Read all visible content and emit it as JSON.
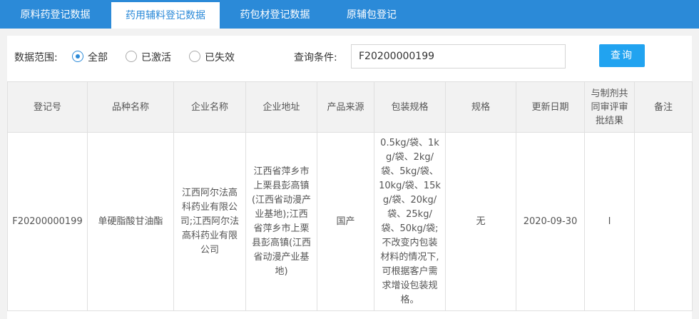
{
  "tabs": [
    {
      "label": "原料药登记数据"
    },
    {
      "label": "药用辅料登记数据"
    },
    {
      "label": "药包材登记数据"
    },
    {
      "label": "原辅包登记"
    }
  ],
  "filter": {
    "scope_label": "数据范围:",
    "options": [
      {
        "label": "全部",
        "selected": true
      },
      {
        "label": "已激活",
        "selected": false
      },
      {
        "label": "已失效",
        "selected": false
      }
    ],
    "query_label": "查询条件:",
    "query_value": "F20200000199",
    "query_button": "查询"
  },
  "table": {
    "headers": [
      "登记号",
      "品种名称",
      "企业名称",
      "企业地址",
      "产品来源",
      "包装规格",
      "规格",
      "更新日期",
      "与制剂共同审评审批结果",
      "备注"
    ],
    "rows": [
      [
        "F20200000199",
        "单硬脂酸甘油酯",
        "江西阿尔法高科药业有限公司;江西阿尔法高科药业有限公司",
        "江西省萍乡市上栗县彭高镇(江西省动漫产业基地);江西省萍乡市上栗县彭高镇(江西省动漫产业基地)",
        "国产",
        "0.5kg/袋、1kg/袋、2kg/袋、5kg/袋、10kg/袋、15kg/袋、20kg/袋、25kg/袋、50kg/袋;不改变内包装材料的情况下,可根据客户需求增设包装规格。",
        "无",
        "2020-09-30",
        "I",
        ""
      ]
    ]
  },
  "colors": {
    "brand": "#2b8ad8",
    "button": "#21a3f0"
  }
}
